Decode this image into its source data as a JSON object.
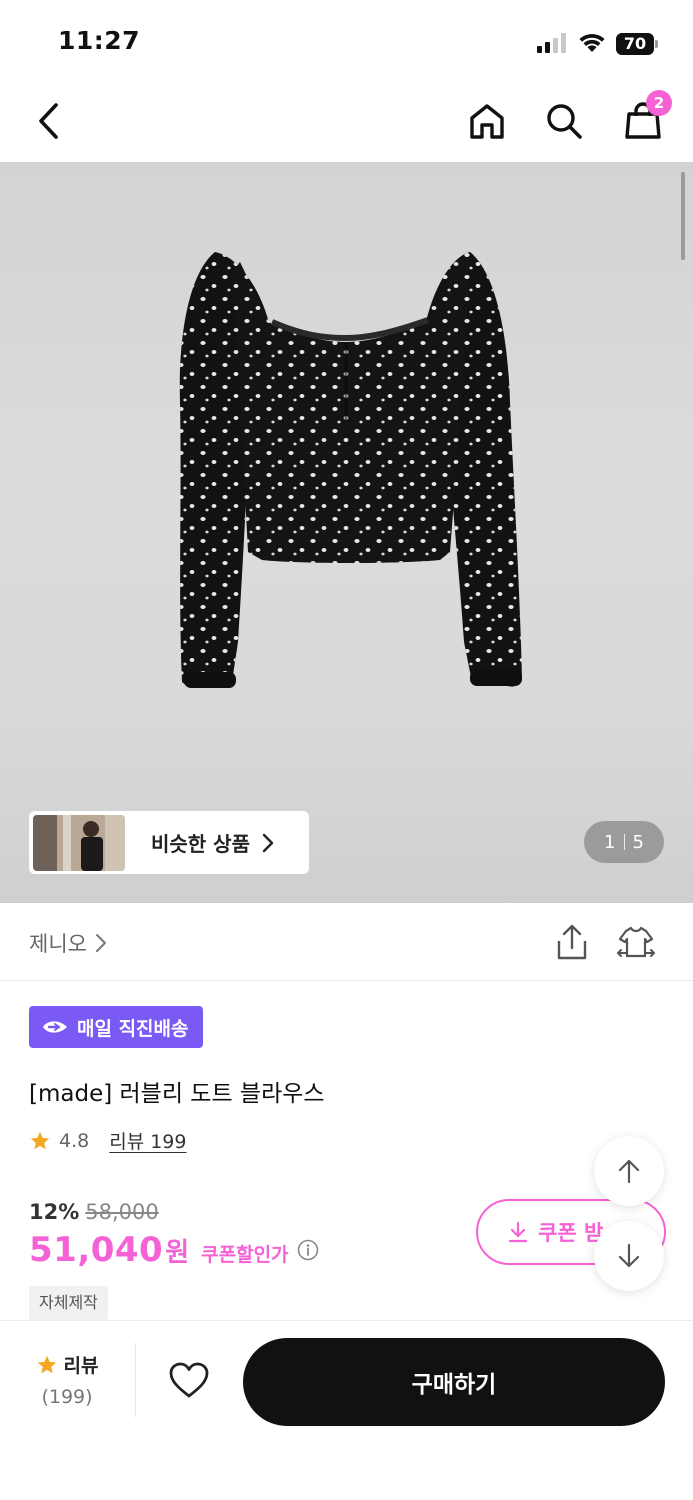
{
  "status_bar": {
    "time": "11:27",
    "battery": "70"
  },
  "nav": {
    "cart_count": "2"
  },
  "gallery": {
    "similar_label": "비슷한 상품",
    "current_page": "1",
    "total_pages": "5"
  },
  "brand": {
    "name": "제니오"
  },
  "product": {
    "delivery_badge": "매일 직진배송",
    "title": "[made] 러블리 도트 블라우스",
    "rating": "4.8",
    "review_link": "리뷰 199",
    "discount_rate": "12%",
    "original_price": "58,000",
    "sale_price": "51,040",
    "price_unit": "원",
    "coupon_price_label": "쿠폰할인가",
    "tag": "자체제작",
    "coupon_button": "쿠폰 받"
  },
  "bottom_bar": {
    "review_label": "리뷰",
    "review_count": "(199)",
    "buy_label": "구매하기"
  },
  "colors": {
    "accent_pink": "#f562d6",
    "delivery_purple": "#7b59f5",
    "star": "#f5a623",
    "buy_button": "#111111"
  },
  "icons": [
    "back-arrow-icon",
    "home-icon",
    "search-icon",
    "shopping-bag-icon",
    "chevron-right-icon",
    "share-icon",
    "fitting-icon",
    "rocket-icon",
    "star-icon",
    "info-icon",
    "download-icon",
    "arrow-up-icon",
    "arrow-down-icon",
    "heart-icon"
  ]
}
